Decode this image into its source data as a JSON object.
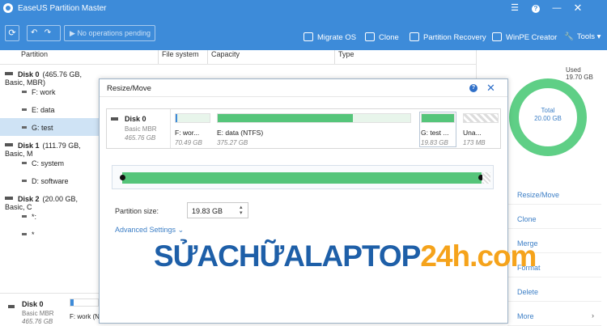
{
  "window": {
    "title": "EaseUS Partition Master",
    "controls": [
      "menu-icon",
      "help-icon",
      "minimize-icon",
      "close-icon"
    ]
  },
  "toolbar": {
    "pending": "No operations pending",
    "tools": [
      "Migrate OS",
      "Clone",
      "Partition Recovery",
      "WinPE Creator",
      "Tools"
    ]
  },
  "table": {
    "columns": [
      "Partition",
      "File system",
      "Capacity",
      "Type"
    ],
    "rows": [
      {
        "label": "Disk 0",
        "detail": "(465.76 GB, Basic, MBR)",
        "kind": "disk"
      },
      {
        "label": "F: work",
        "kind": "part"
      },
      {
        "label": "E: data",
        "kind": "part"
      },
      {
        "label": "G: test",
        "kind": "part",
        "selected": true
      },
      {
        "label": "Disk 1",
        "detail": "(111.79 GB, Basic, M",
        "kind": "disk"
      },
      {
        "label": "C: system",
        "kind": "part"
      },
      {
        "label": "D: software",
        "kind": "part"
      },
      {
        "label": "Disk 2",
        "detail": "(20.00 GB, Basic, C",
        "kind": "disk"
      },
      {
        "label": "*:",
        "kind": "part"
      },
      {
        "label": "*",
        "kind": "part"
      }
    ]
  },
  "bottom_disk": {
    "name": "Disk 0",
    "type": "Basic MBR",
    "size": "465.76 GB",
    "part": "F: work (N"
  },
  "right_panel": {
    "used_label": "Used",
    "used_value": "19.70 GB",
    "total_label": "Total",
    "total_value": "20.00 GB",
    "used_fraction": 0.985,
    "operations": [
      "Resize/Move",
      "Clone",
      "Merge",
      "Format",
      "Delete",
      "More"
    ]
  },
  "dialog": {
    "title": "Resize/Move",
    "disk": {
      "name": "Disk 0",
      "type": "Basic MBR",
      "size": "465.76 GB"
    },
    "partitions": [
      {
        "name": "F: wor...",
        "size": "70.49 GB",
        "used_fraction": 0.05
      },
      {
        "name": "E: data (NTFS)",
        "size": "375.27 GB",
        "used_fraction": 0.7
      },
      {
        "name": "G: test ...",
        "size": "19.83 GB",
        "used_fraction": 1.0
      },
      {
        "name": "Una...",
        "size": "173 MB",
        "used_fraction": 0
      }
    ],
    "partition_size_label": "Partition size:",
    "partition_size_value": "19.83 GB",
    "advanced_settings": "Advanced Settings"
  },
  "watermark": {
    "part1": "SỬACHỮALAPTOP",
    "part2": "24h.com",
    "color1": "#1e5fa8",
    "color2": "#f5a31b"
  },
  "colors": {
    "accent": "#3d8bd9",
    "green": "#55c57a",
    "link": "#3d7fc6"
  }
}
